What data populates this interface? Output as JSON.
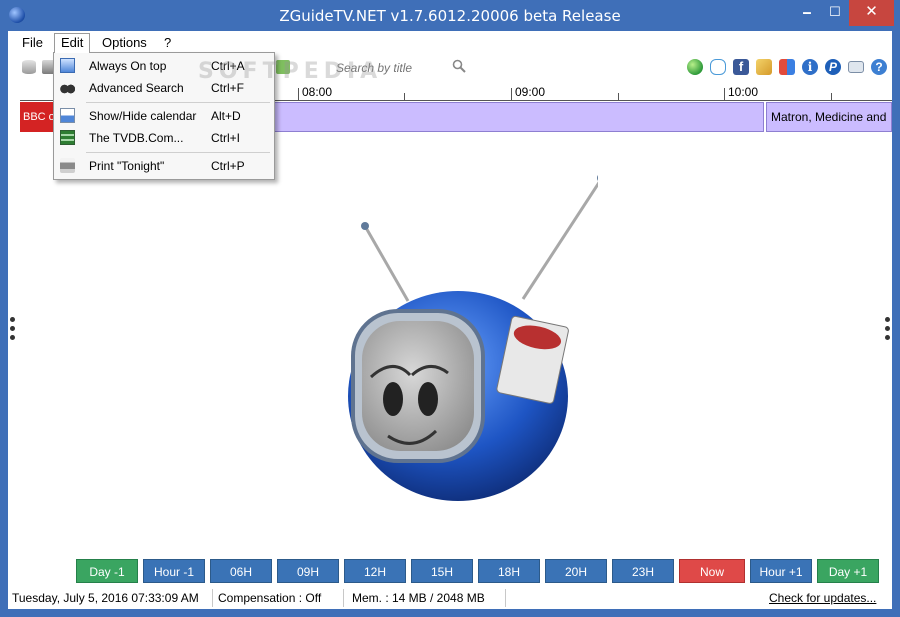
{
  "window": {
    "title": "ZGuideTV.NET v1.7.6012.20006 beta Release"
  },
  "controls": {
    "minimize": "🗕",
    "maximize": "☐",
    "close": "✕"
  },
  "menu": {
    "file": "File",
    "edit": "Edit",
    "options": "Options",
    "help": "?"
  },
  "search": {
    "placeholder": "Search by title"
  },
  "toolbar": {
    "facebook_glyph": "f",
    "info_glyph": "i",
    "paypal_glyph": "P",
    "help_glyph": "?"
  },
  "timeline": {
    "hours": [
      "08:00",
      "09:00",
      "10:00"
    ]
  },
  "channel": {
    "logo_text": "BBC one",
    "next_program": "Matron, Medicine and"
  },
  "edit_menu": {
    "items": [
      {
        "label": "Always On top",
        "shortcut": "Ctrl+A",
        "icon": "window-icon"
      },
      {
        "label": "Advanced Search",
        "shortcut": "Ctrl+F",
        "icon": "binoculars-icon"
      },
      {
        "label": "Show/Hide calendar",
        "shortcut": "Alt+D",
        "icon": "calendar-icon"
      },
      {
        "label": "The TVDB.Com...",
        "shortcut": "Ctrl+I",
        "icon": "film-icon"
      },
      {
        "label": "Print \"Tonight\"",
        "shortcut": "Ctrl+P",
        "icon": "printer-icon"
      }
    ]
  },
  "nav_buttons": [
    "Day -1",
    "Hour -1",
    "06H",
    "09H",
    "12H",
    "15H",
    "18H",
    "20H",
    "23H",
    "Now",
    "Hour +1",
    "Day +1"
  ],
  "status": {
    "datetime": "Tuesday, July 5, 2016  07:33:09 AM",
    "compensation": "Compensation :  Off",
    "memory": "Mem. :  14 MB / 2048 MB",
    "check_updates": "Check for updates..."
  },
  "colors": {
    "titlebar": "#3f6fb8",
    "nav_blue": "#3a73b6",
    "nav_green": "#3aa561",
    "nav_red": "#df4948",
    "program_bar": "#cbbcff"
  },
  "watermark": "SOFTPEDIA"
}
